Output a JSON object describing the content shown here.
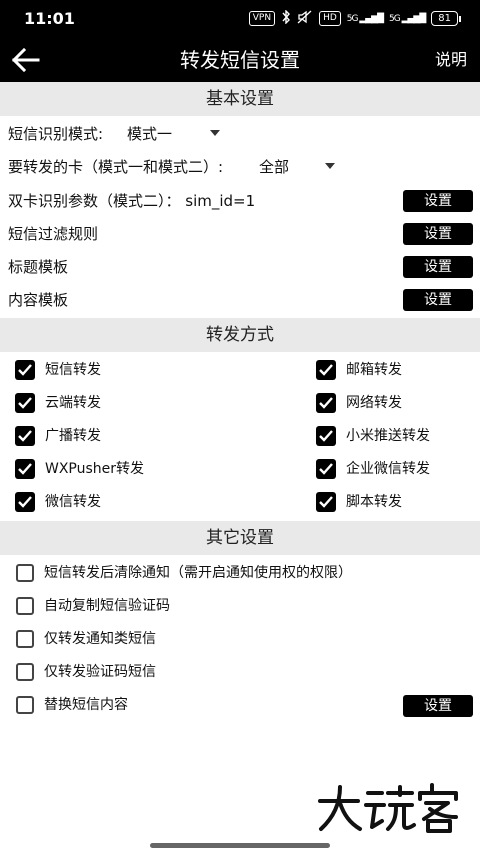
{
  "status_bar": {
    "time": "11:01",
    "vpn": "VPN",
    "hd": "HD",
    "net1": "5G",
    "net2": "5G",
    "battery": "81"
  },
  "header": {
    "title": "转发短信设置",
    "help_label": "说明"
  },
  "basic": {
    "title": "基本设置",
    "recognition_label": "短信识别模式:",
    "recognition_value": "模式一",
    "card_label": "要转发的卡（模式一和模式二）:",
    "card_value": "全部",
    "dual_label": "双卡识别参数（模式二）：  sim_id=1",
    "filter_label": "短信过滤规则",
    "title_template_label": "标题模板",
    "content_template_label": "内容模板",
    "set_label": "设置"
  },
  "forward": {
    "title": "转发方式",
    "left": [
      {
        "label": "短信转发",
        "checked": true
      },
      {
        "label": "云端转发",
        "checked": true
      },
      {
        "label": "广播转发",
        "checked": true
      },
      {
        "label": "WXPusher转发",
        "checked": true
      },
      {
        "label": "微信转发",
        "checked": true
      }
    ],
    "right": [
      {
        "label": "邮箱转发",
        "checked": true
      },
      {
        "label": "网络转发",
        "checked": true
      },
      {
        "label": "小米推送转发",
        "checked": true
      },
      {
        "label": "企业微信转发",
        "checked": true
      },
      {
        "label": "脚本转发",
        "checked": true
      }
    ]
  },
  "other": {
    "title": "其它设置",
    "items": [
      {
        "label": "短信转发后清除通知（需开启通知使用权的权限）",
        "checked": false
      },
      {
        "label": "自动复制短信验证码",
        "checked": false
      },
      {
        "label": "仅转发通知类短信",
        "checked": false
      },
      {
        "label": "仅转发验证码短信",
        "checked": false
      },
      {
        "label": "替换短信内容",
        "checked": false
      }
    ],
    "set_label": "设置"
  },
  "watermark": "大玩客"
}
